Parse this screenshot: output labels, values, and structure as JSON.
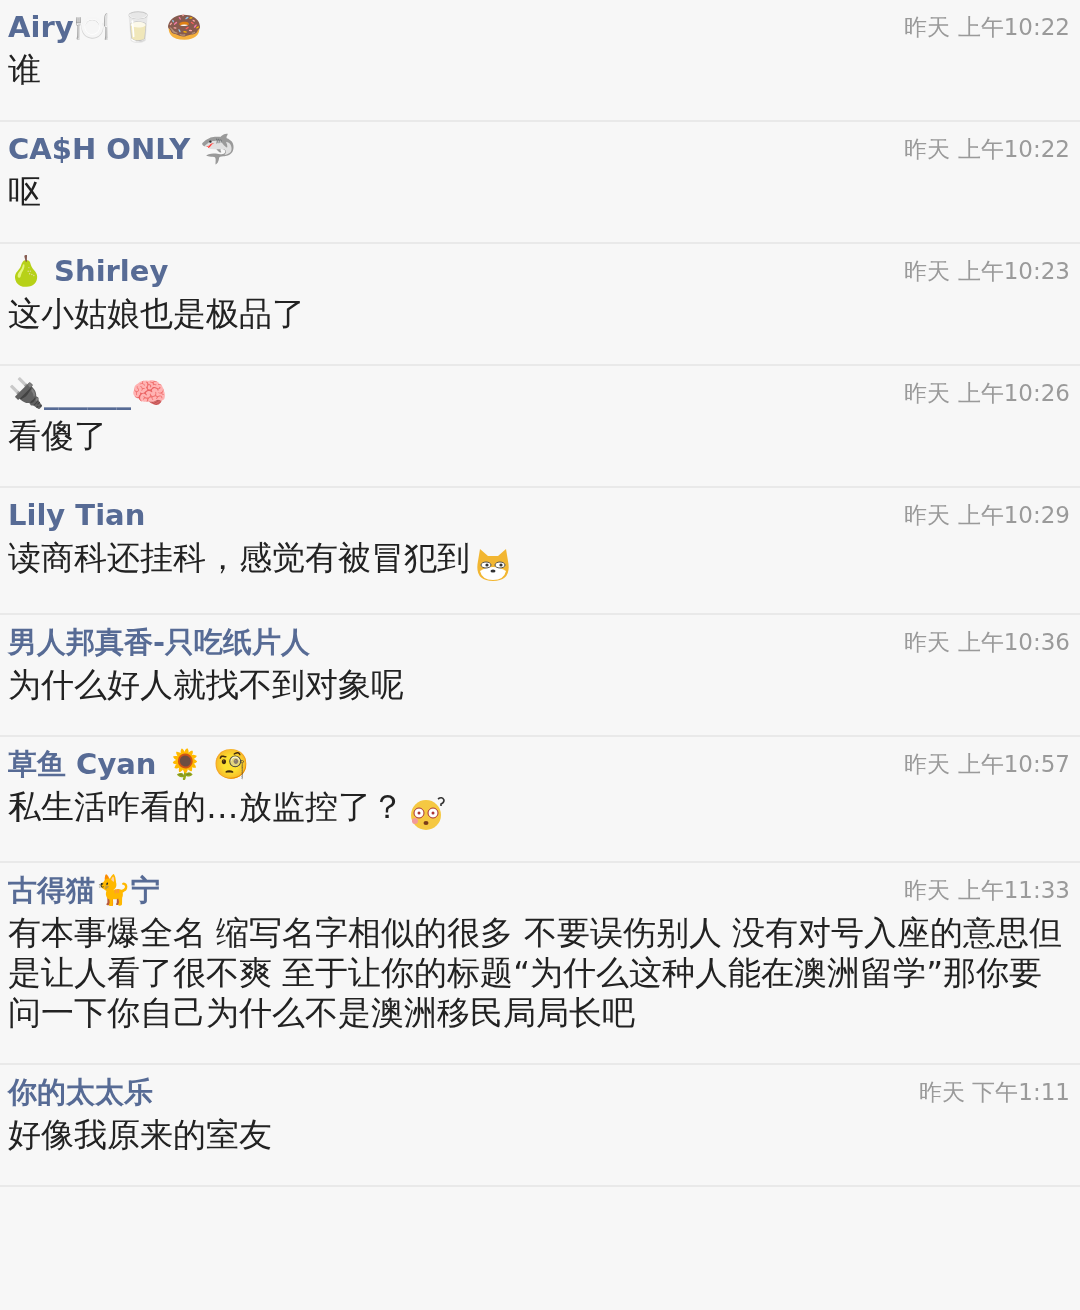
{
  "comments": [
    {
      "name": "Airy🍽️ 🥛 🍩",
      "time": "昨天 上午10:22",
      "message": "谁"
    },
    {
      "name": "CA$H ONLY 🦈",
      "time": "昨天 上午10:22",
      "message": "呕"
    },
    {
      "name": "🍐 Shirley",
      "time": "昨天 上午10:23",
      "message": "这小姑娘也是极品了"
    },
    {
      "name": "🔌______🧠",
      "time": "昨天 上午10:26",
      "message": "看傻了"
    },
    {
      "name": "Lily Tian",
      "time": "昨天 上午10:29",
      "message": "读商科还挂科，感觉有被冒犯到",
      "kind": "doge"
    },
    {
      "name": "男人邦真香-只吃纸片人",
      "time": "昨天 上午10:36",
      "message": "为什么好人就找不到对象呢"
    },
    {
      "name": "草鱼 Cyan 🌻 🧐",
      "time": "昨天 上午10:57",
      "message": "私生活咋看的…放监控了？",
      "kind": "dizzy"
    },
    {
      "name": "古得猫🐈宁",
      "time": "昨天 上午11:33",
      "message": "有本事爆全名 缩写名字相似的很多 不要误伤别人 没有对号入座的意思但是让人看了很不爽 至于让你的标题“为什么这种人能在澳洲留学”那你要问一下你自己为什么不是澳洲移民局局长吧"
    },
    {
      "name": "你的太太乐",
      "time": "昨天 下午1:11",
      "message": "好像我原来的室友"
    }
  ]
}
